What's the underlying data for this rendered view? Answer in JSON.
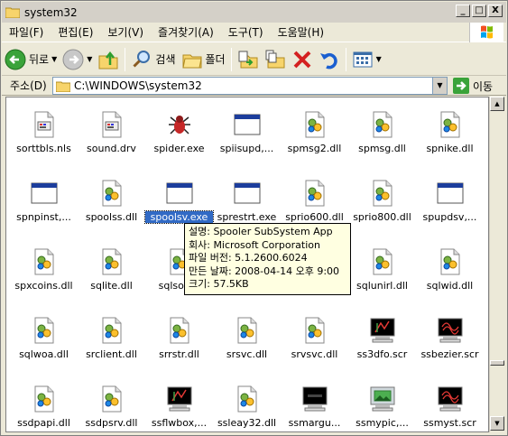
{
  "window": {
    "title": "system32",
    "controls": {
      "minimize": "_",
      "maximize": "□",
      "close": "X"
    }
  },
  "menu": [
    "파일(F)",
    "편집(E)",
    "보기(V)",
    "즐겨찾기(A)",
    "도구(T)",
    "도움말(H)"
  ],
  "toolbar": {
    "back": "뒤로",
    "search": "검색",
    "folders": "폴더"
  },
  "address": {
    "label": "주소(D)",
    "value": "C:\\WINDOWS\\system32",
    "go": "이동"
  },
  "files": [
    {
      "name": "sorttbls.nls",
      "icon": "settings-file-icon"
    },
    {
      "name": "sound.drv",
      "icon": "settings-file-icon"
    },
    {
      "name": "spider.exe",
      "icon": "spider-icon"
    },
    {
      "name": "spiisupd,...",
      "icon": "app-window-icon"
    },
    {
      "name": "spmsg2.dll",
      "icon": "dll-icon"
    },
    {
      "name": "spmsg.dll",
      "icon": "dll-icon"
    },
    {
      "name": "spnike.dll",
      "icon": "dll-icon"
    },
    {
      "name": "spnpinst,...",
      "icon": "app-window-icon"
    },
    {
      "name": "spoolss.dll",
      "icon": "dll-icon"
    },
    {
      "name": "spoolsv.exe",
      "icon": "app-window-icon",
      "selected": true
    },
    {
      "name": "sprestrt.exe",
      "icon": "app-window-icon"
    },
    {
      "name": "sprio600.dll",
      "icon": "dll-icon"
    },
    {
      "name": "sprio800.dll",
      "icon": "dll-icon"
    },
    {
      "name": "spupdsv,...",
      "icon": "app-window-icon"
    },
    {
      "name": "spxcoins.dll",
      "icon": "dll-icon"
    },
    {
      "name": "sqlite.dll",
      "icon": "dll-icon"
    },
    {
      "name": "sqlsod...",
      "icon": "dll-icon"
    },
    {
      "name": "",
      "icon": "dll-icon"
    },
    {
      "name": "",
      "icon": "dll-icon"
    },
    {
      "name": "sqlunirl.dll",
      "icon": "dll-icon"
    },
    {
      "name": "sqlwid.dll",
      "icon": "dll-icon"
    },
    {
      "name": "sqlwoa.dll",
      "icon": "dll-icon"
    },
    {
      "name": "srclient.dll",
      "icon": "dll-icon"
    },
    {
      "name": "srrstr.dll",
      "icon": "dll-icon"
    },
    {
      "name": "srsvc.dll",
      "icon": "dll-icon"
    },
    {
      "name": "srvsvc.dll",
      "icon": "dll-icon"
    },
    {
      "name": "ss3dfo.scr",
      "icon": "screensaver-icon"
    },
    {
      "name": "ssbezier.scr",
      "icon": "screensaver-red-icon"
    },
    {
      "name": "ssdpapi.dll",
      "icon": "dll-icon"
    },
    {
      "name": "ssdpsrv.dll",
      "icon": "dll-icon"
    },
    {
      "name": "ssflwbox,...",
      "icon": "screensaver-icon"
    },
    {
      "name": "ssleay32.dll",
      "icon": "dll-icon"
    },
    {
      "name": "ssmargu...",
      "icon": "screensaver-dark-icon"
    },
    {
      "name": "ssmypic,...",
      "icon": "screensaver-picture-icon"
    },
    {
      "name": "ssmyst.scr",
      "icon": "screensaver-red-icon"
    }
  ],
  "tooltip": [
    "설명: Spooler SubSystem App",
    "회사: Microsoft Corporation",
    "파일 버전: 5.1.2600.6024",
    "만든 날짜: 2008-04-14 오후 9:00",
    "크기: 57.5KB"
  ]
}
